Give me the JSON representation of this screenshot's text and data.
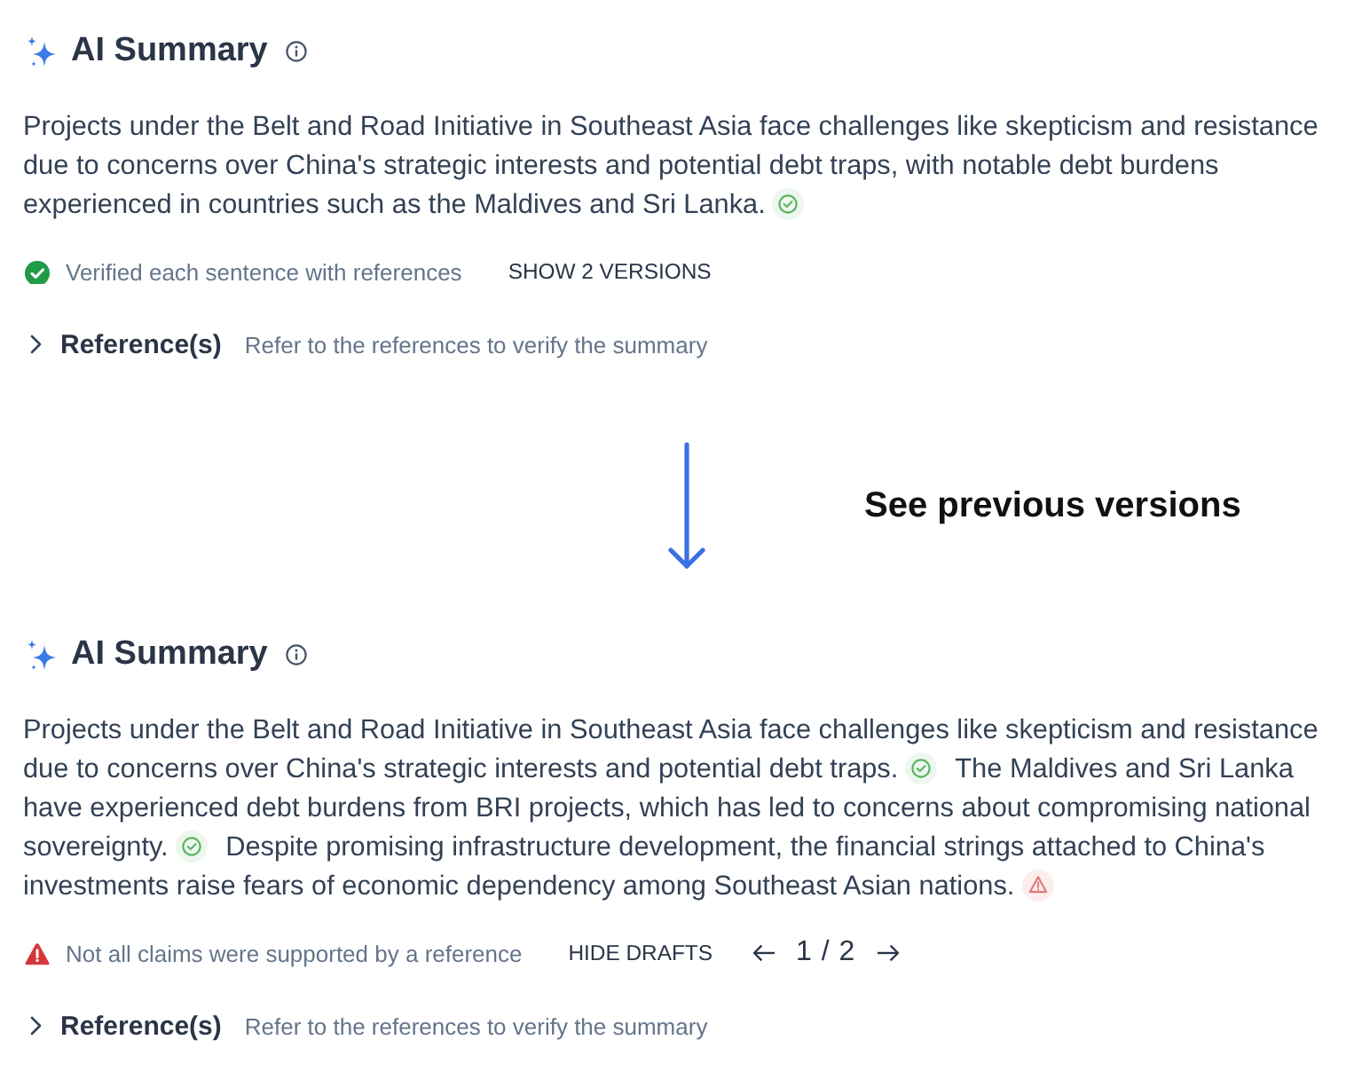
{
  "items": [
    {
      "kind": "summary",
      "title": "AI Summary",
      "sentences": [
        {
          "text": "Projects under the Belt and Road Initiative in Southeast Asia face challenges like skepticism and resistance due to concerns over China's strategic interests and potential debt traps, with notable debt burdens experienced in countries such as the Maldives and Sri Lanka.",
          "supported": true
        }
      ],
      "verification": {
        "all_supported": true,
        "text": "Verified each sentence with references"
      },
      "toggle": "SHOW 2 VERSIONS",
      "references": {
        "label": "Reference(s)",
        "hint": "Refer to the references to verify the summary",
        "expanded": false
      }
    },
    {
      "kind": "callout",
      "text": "See previous versions"
    },
    {
      "kind": "summary",
      "title": "AI Summary",
      "sentences": [
        {
          "text": "Projects under the Belt and Road Initiative in Southeast Asia face challenges like skepticism and resistance due to concerns over China's strategic interests and potential debt traps.",
          "supported": true
        },
        {
          "text": "The Maldives and Sri Lanka have experienced debt burdens from BRI projects, which has led to concerns about compromising national sovereignty.",
          "supported": true
        },
        {
          "text": "Despite promising infrastructure development, the financial strings attached to China's investments raise fears of economic dependency among Southeast Asian nations.",
          "supported": false
        }
      ],
      "verification": {
        "all_supported": false,
        "text": "Not all claims were supported by a reference"
      },
      "toggle": "HIDE DRAFTS",
      "pager": {
        "position": "1 / 2"
      },
      "references": {
        "label": "Reference(s)",
        "hint": "Refer to the references to verify the summary",
        "expanded": false
      }
    }
  ]
}
